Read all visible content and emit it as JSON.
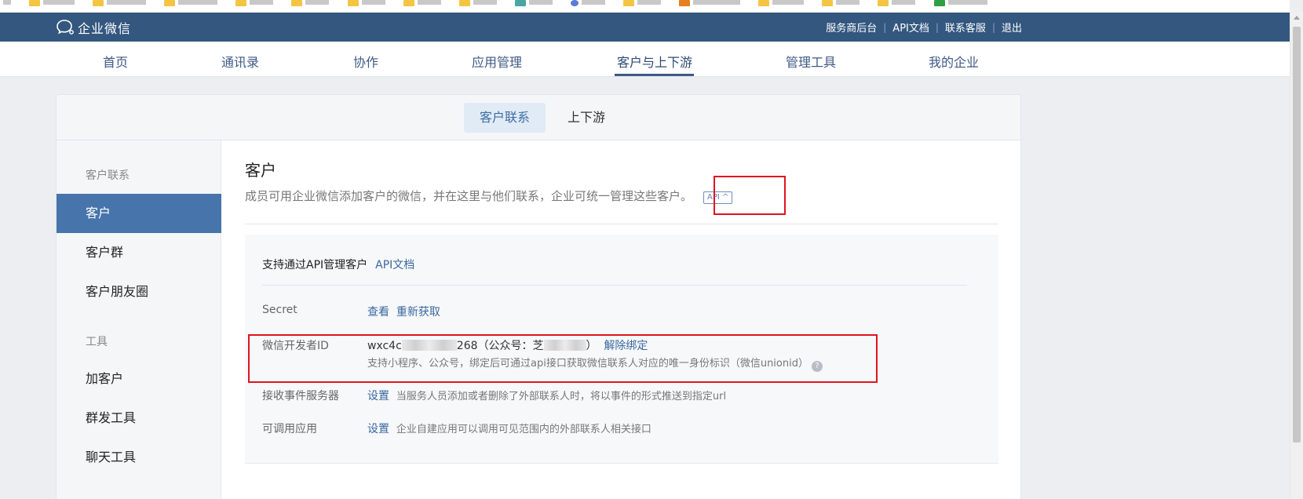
{
  "topbar": {
    "logo_text": "企业微信",
    "links": [
      "服务商后台",
      "API文档",
      "联系客服",
      "退出"
    ],
    "separator": "|"
  },
  "nav": {
    "items": [
      "首页",
      "通讯录",
      "协作",
      "应用管理",
      "客户与上下游",
      "管理工具",
      "我的企业"
    ],
    "active_index": 4
  },
  "subtabs": [
    "客户联系",
    "上下游"
  ],
  "sidebar": {
    "group1": "客户联系",
    "items1": [
      "客户",
      "客户群",
      "客户朋友圈"
    ],
    "group2": "工具",
    "items2": [
      "加客户",
      "群发工具",
      "聊天工具"
    ]
  },
  "content": {
    "title": "客户",
    "description": "成员可用企业微信添加客户的微信，并在这里与他们联系，企业可统一管理这些客户。",
    "api_badge": "API",
    "api_badge_arrow": "^",
    "panel_heading": "支持通过API管理客户",
    "panel_heading_link": "API文档",
    "secret_label": "Secret",
    "secret_view": "查看",
    "secret_refresh": "重新获取",
    "devid_label": "微信开发者ID",
    "devid_prefix": "wxc4c",
    "devid_suffix": "268（公众号：芝",
    "devid_close": "）",
    "devid_unbind": "解除绑定",
    "devid_note": "支持小程序、公众号，绑定后可通过api接口获取微信联系人对应的唯一身份标识（微信unionid）",
    "help_glyph": "?",
    "event_label": "接收事件服务器",
    "event_set": "设置",
    "event_note": "当服务人员添加或者删除了外部联系人时，将以事件的形式推送到指定url",
    "app_label": "可调用应用",
    "app_set": "设置",
    "app_note": "企业自建应用可以调用可见范围内的外部联系人相关接口"
  },
  "colors": {
    "topbar": "#33577f",
    "accent": "#4674ab",
    "link": "#3a679f",
    "highlight_box": "#e0141e"
  }
}
